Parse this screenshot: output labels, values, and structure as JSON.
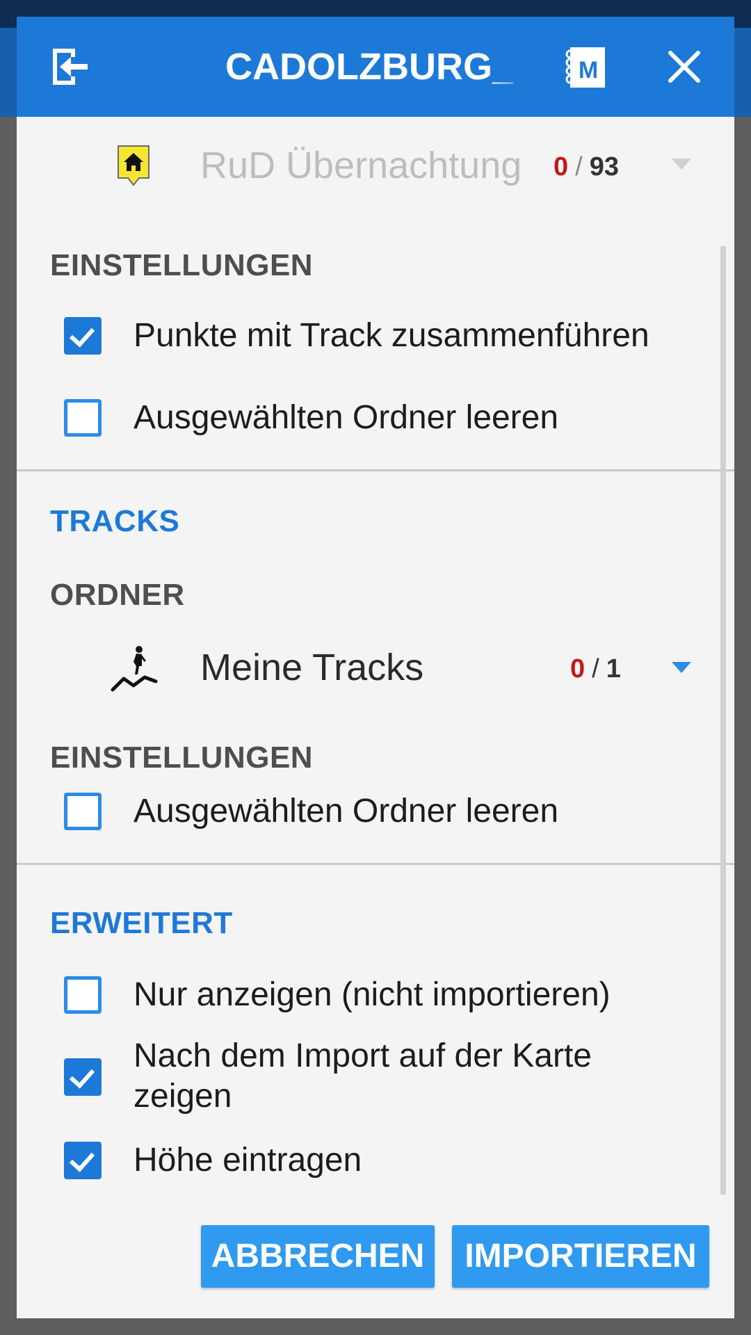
{
  "dialog": {
    "title": "CADOLZBURG_",
    "icons": {
      "back": "exit-icon",
      "notebook": "notebook-m-icon",
      "close": "close-icon"
    }
  },
  "points": {
    "folder_icon": "home-marker-icon",
    "folder_name": "RuD Übernachtung",
    "selected": "0",
    "slash": "/",
    "total": "93",
    "settings_label": "EINSTELLUNGEN",
    "options": [
      {
        "label": "Punkte mit Track zusammenführen",
        "checked": true
      },
      {
        "label": "Ausgewählten Ordner leeren",
        "checked": false
      }
    ]
  },
  "tracks": {
    "section_label": "TRACKS",
    "folder_label": "ORDNER",
    "folder_icon": "hiker-icon",
    "folder_name": "Meine Tracks",
    "selected": "0",
    "slash": "/",
    "total": "1",
    "settings_label": "EINSTELLUNGEN",
    "options": [
      {
        "label": "Ausgewählten Ordner leeren",
        "checked": false
      }
    ]
  },
  "advanced": {
    "section_label": "ERWEITERT",
    "options": [
      {
        "label": "Nur anzeigen (nicht importieren)",
        "checked": false
      },
      {
        "label": "Nach dem Import auf der Karte zeigen",
        "checked": true
      },
      {
        "label": "Höhe eintragen",
        "checked": true
      }
    ]
  },
  "buttons": {
    "cancel": "ABBRECHEN",
    "import": "IMPORTIEREN"
  },
  "colors": {
    "accent": "#1d79d7",
    "button": "#2f9aef",
    "count_red": "#c21818"
  }
}
